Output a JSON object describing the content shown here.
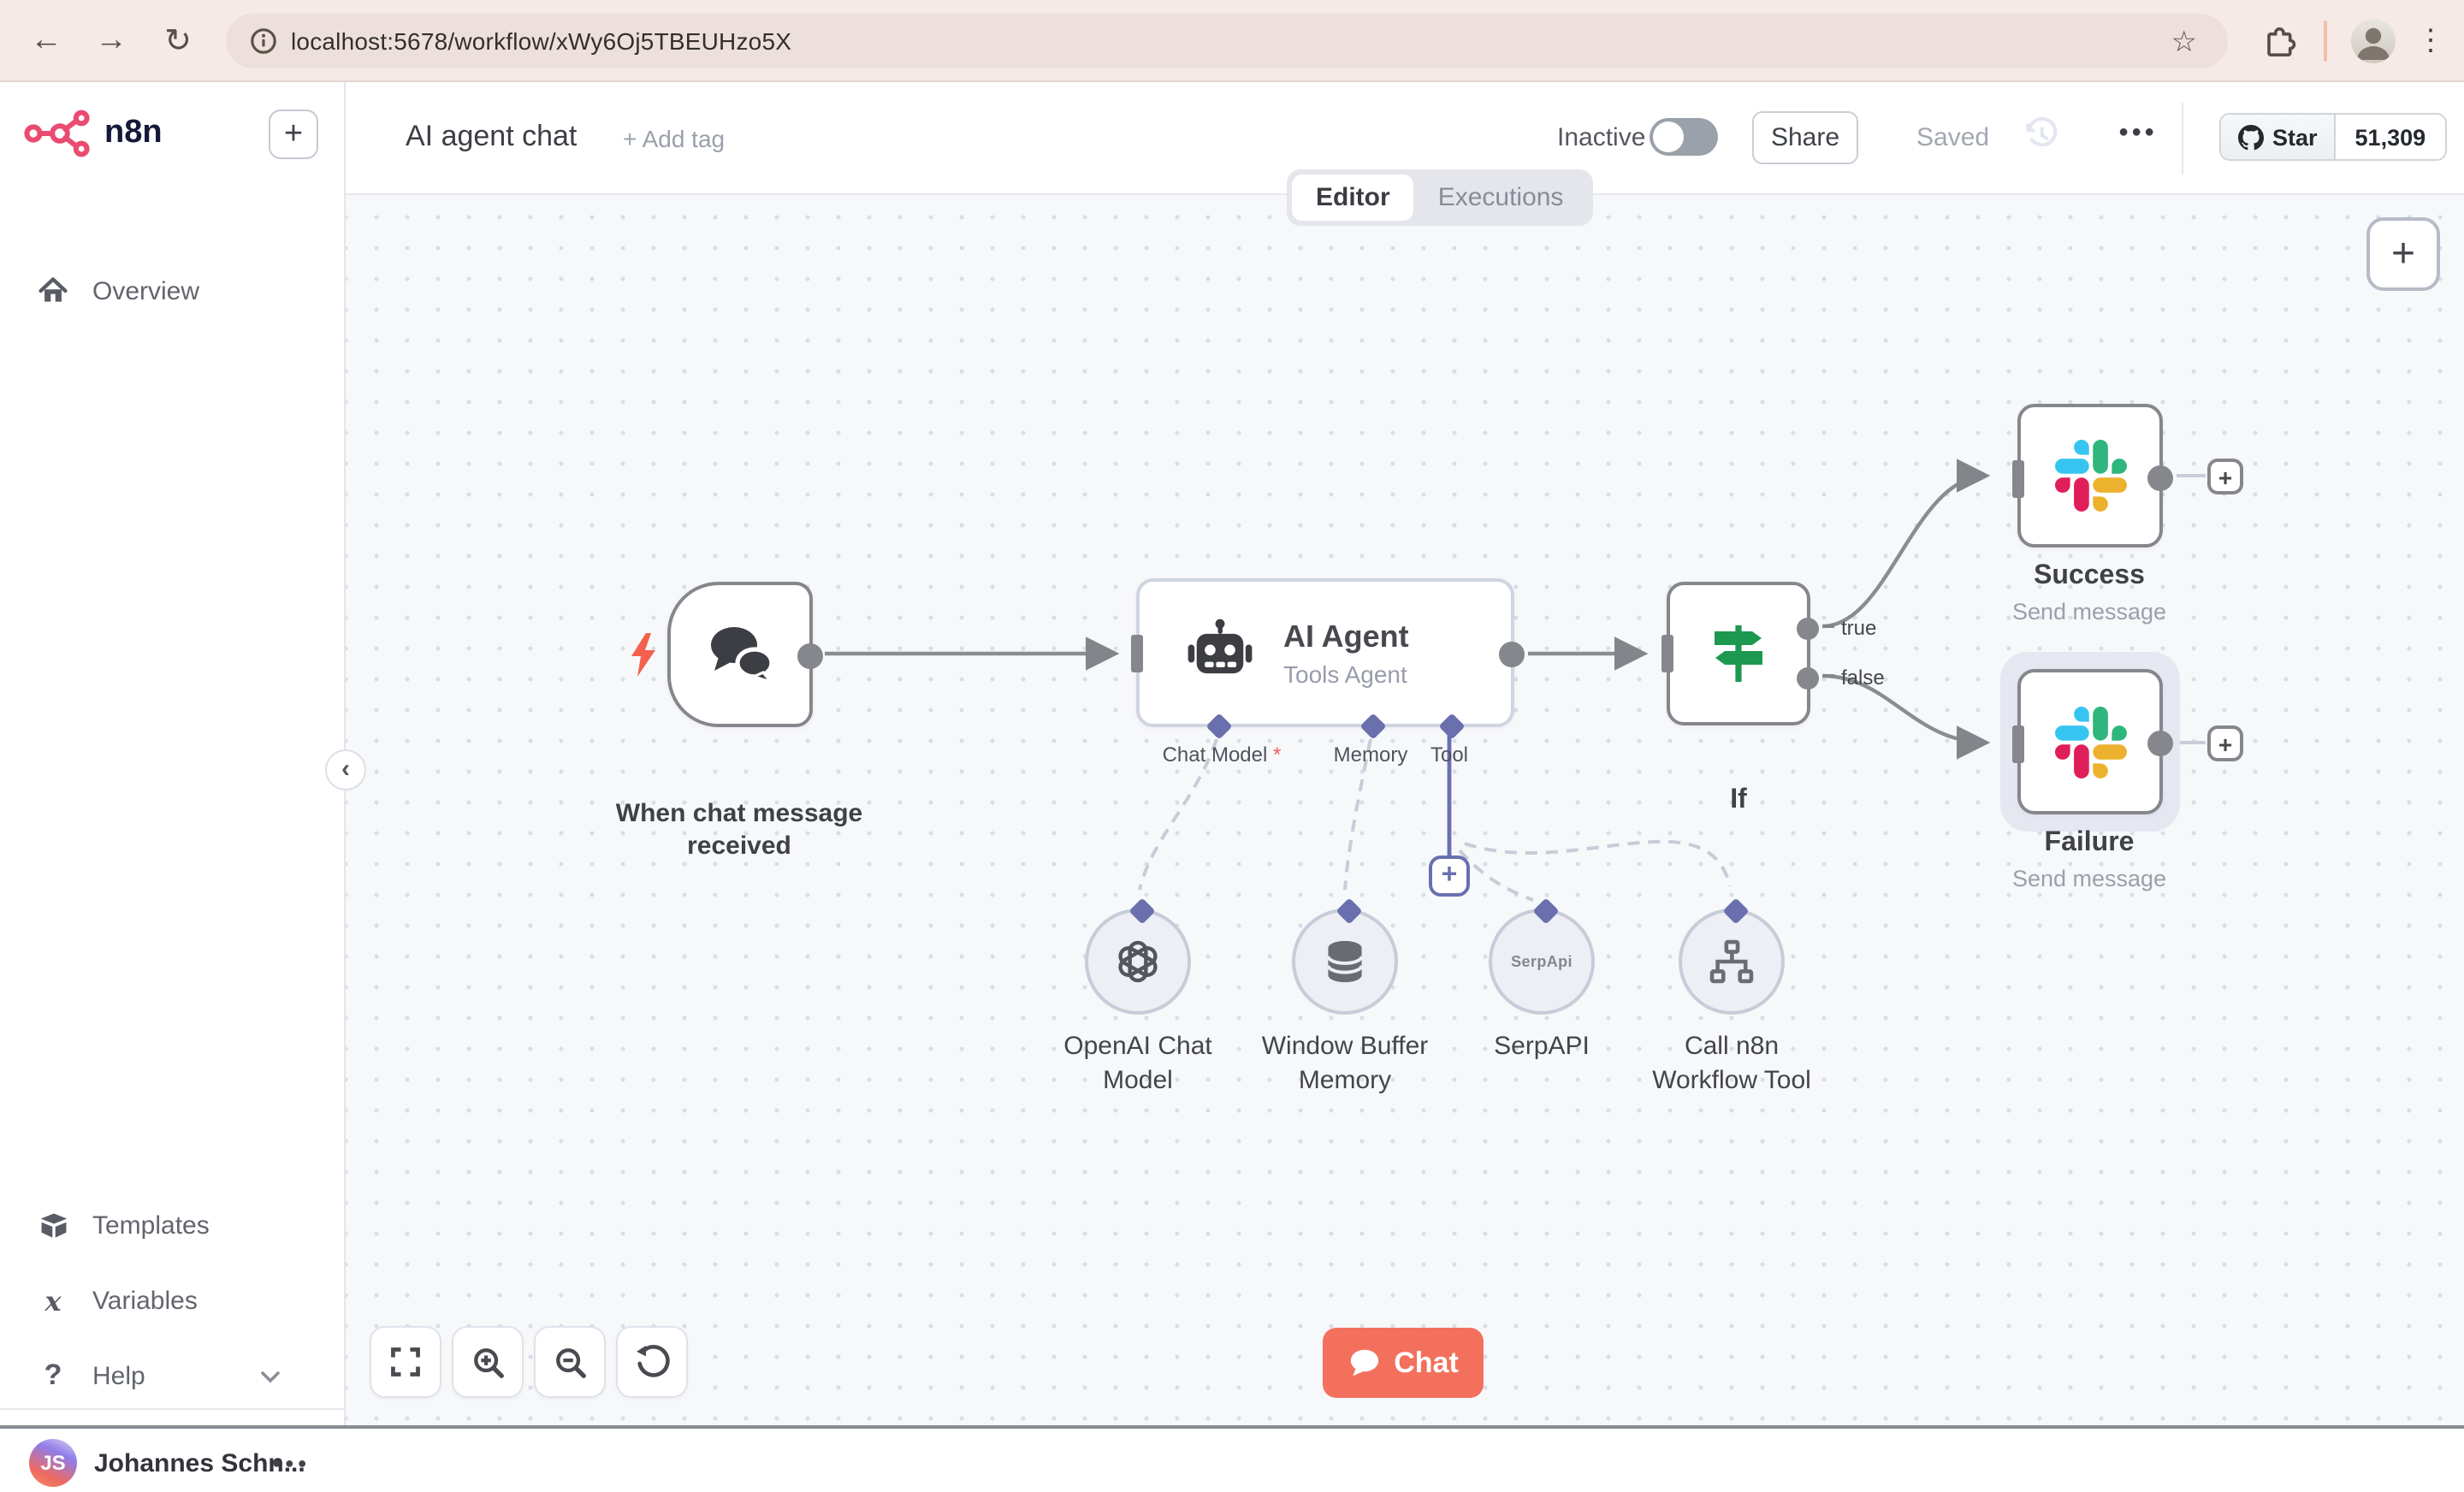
{
  "browser": {
    "url": "localhost:5678/workflow/xWy6Oj5TBEUHzo5X"
  },
  "sidebar": {
    "logo_text": "n8n",
    "add_button_glyph": "+",
    "overview_label": "Overview",
    "templates_label": "Templates",
    "variables_label": "Variables",
    "variables_glyph": "x",
    "help_label": "Help",
    "help_glyph": "?",
    "user": {
      "initials": "JS",
      "name": "Johannes Schn...",
      "menu_glyph": "●●●"
    }
  },
  "header": {
    "title": "AI agent chat",
    "add_tag_label": "+ Add tag",
    "inactive_label": "Inactive",
    "share_label": "Share",
    "saved_label": "Saved",
    "menu_glyph": "●●●",
    "github": {
      "star_label": "Star",
      "star_count": "51,309"
    }
  },
  "tabs": {
    "editor_label": "Editor",
    "executions_label": "Executions"
  },
  "canvas": {
    "add_node_glyph": "+",
    "chat_button_label": "Chat",
    "trigger": {
      "label": "When chat message received"
    },
    "agent": {
      "title": "AI Agent",
      "subtitle": "Tools Agent",
      "port_chat_model": "Chat Model",
      "required_marker": "*",
      "port_memory": "Memory",
      "port_tool": "Tool",
      "add_tool_glyph": "+"
    },
    "if": {
      "label": "If",
      "true_label": "true",
      "false_label": "false"
    },
    "success": {
      "label": "Success",
      "subtitle": "Send message",
      "add_glyph": "+"
    },
    "failure": {
      "label": "Failure",
      "subtitle": "Send message",
      "add_glyph": "+"
    },
    "subnodes": {
      "openai": {
        "label": "OpenAI Chat Model"
      },
      "window_memory": {
        "label": "Window Buffer Memory"
      },
      "serpapi": {
        "label": "SerpAPI",
        "badge": "SerpApi"
      },
      "call_workflow": {
        "label": "Call n8n Workflow Tool"
      }
    }
  },
  "colors": {
    "accent_coral": "#f3705c",
    "logo_pink": "#ea4b71",
    "connector_purple": "#6a6fae",
    "edge_gray": "#83858b",
    "if_green": "#1d9850",
    "slack_blue": "#36C5F0",
    "slack_green": "#2EB67D",
    "slack_yellow": "#ECB22E",
    "slack_red": "#E01E5A",
    "canvas_bg": "#f7f8fa"
  }
}
